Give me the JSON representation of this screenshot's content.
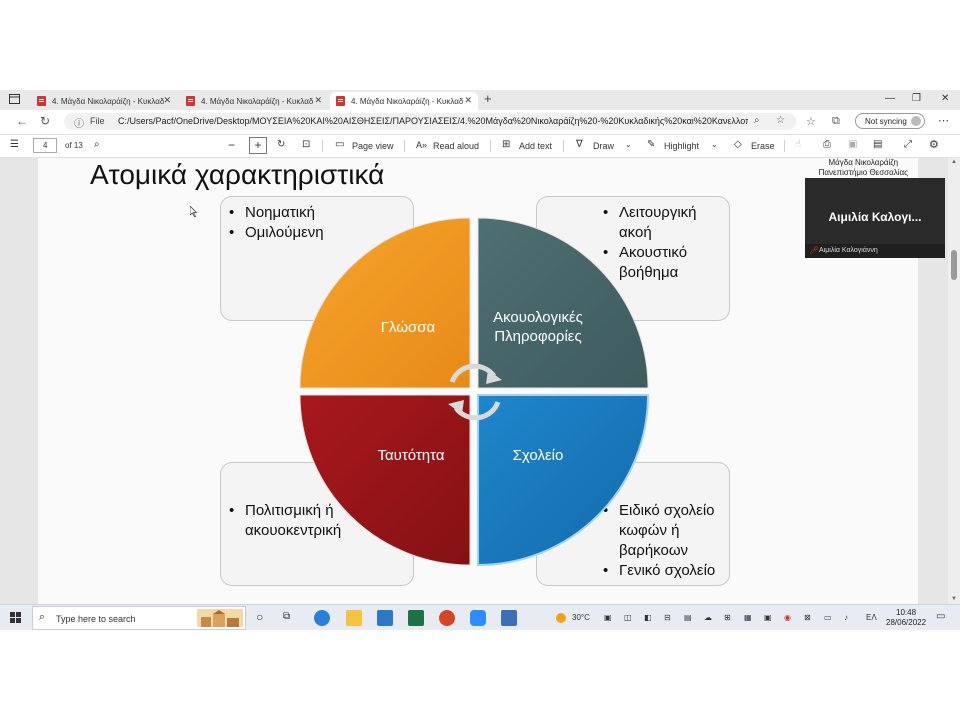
{
  "browser": {
    "tabs": [
      {
        "title": "4. Μάγδα Νικολαράίζη - Κυκλαδ",
        "active": false
      },
      {
        "title": "4. Μάγδα Νικολαράίζη - Κυκλαδ",
        "active": false
      },
      {
        "title": "4. Μάγδα Νικολαράίζη - Κυκλαδ",
        "active": true
      }
    ],
    "address": {
      "file_label": "File",
      "url": "C:/Users/Pacf/OneDrive/Desktop/ΜΟΥΣΕΙΑ%20ΚΑΙ%20ΑΙΣΘΗΣΕΙΣ/ΠΑΡΟΥΣΙΑΣΕΙΣ/4.%20Μάγδα%20Νικολαράίζη%20-%20Κυκλαδικής%20και%20Κανελλοπούλο..."
    },
    "sync_label": "Not syncing"
  },
  "pdf_toolbar": {
    "page_current": "4",
    "page_total": "of 13",
    "page_view": "Page view",
    "read_aloud": "Read aloud",
    "add_text": "Add text",
    "draw": "Draw",
    "highlight": "Highlight",
    "erase": "Erase"
  },
  "slide": {
    "title": "Ατομικά χαρακτηριστικά",
    "corner_name": "Μάγδα Νικολαράίζη",
    "corner_affiliation": "Πανεπιστήμιο Θεσσαλίας",
    "top_left_box": [
      "Νοηματική",
      "Ομιλούμενη"
    ],
    "top_right_box": [
      "Λειτουργική ακοή",
      "Ακουστικό βοήθημα"
    ],
    "bottom_left_box": [
      "Πολιτισμική ή ακουοκεντρική"
    ],
    "bottom_right_box": [
      "Ειδικό σχολείο κωφών ή βαρήκοων",
      "Γενικό σχολείο"
    ],
    "quadrants": {
      "top_left": "Γλώσσα",
      "top_right_line1": "Ακουολογικές",
      "top_right_line2": "Πληροφορίες",
      "bottom_left": "Ταυτότητα",
      "bottom_right": "Σχολείο"
    },
    "colors": {
      "language": "#ef9420",
      "audiological": "#456468",
      "identity": "#951418",
      "school": "#1777bd"
    }
  },
  "video_overlay": {
    "display_name": "Αιμιλία Καλογι...",
    "participant_label": "Αιμιλία Καλογιάννη"
  },
  "taskbar": {
    "search_placeholder": "Type here to search",
    "temperature": "30°C",
    "language": "ΕΛ",
    "time": "10:48",
    "date": "28/06/2022"
  }
}
